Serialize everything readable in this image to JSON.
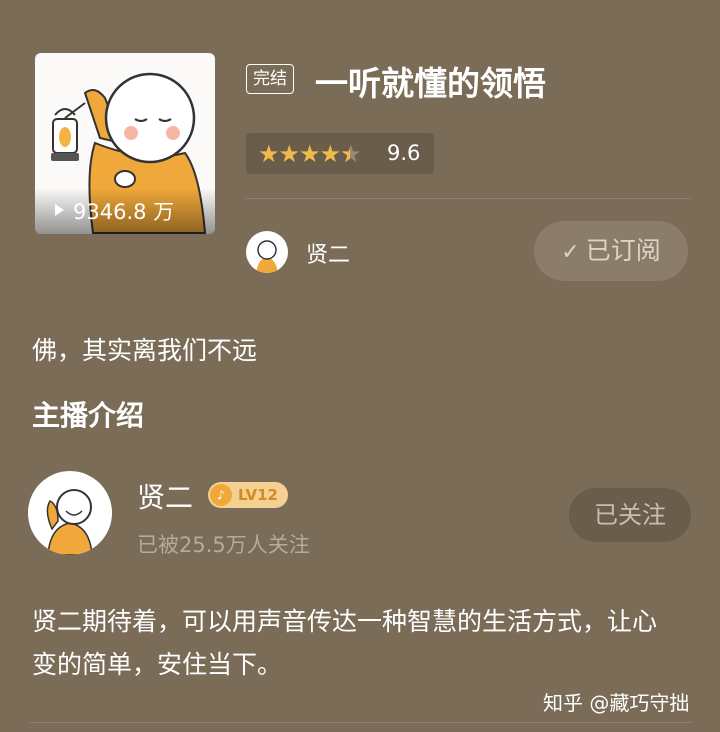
{
  "album": {
    "play_count": "9346.8 万",
    "status_badge": "完结",
    "title": "一听就懂的领悟",
    "stars": "★★★★",
    "half_star": "★",
    "score": "9.6",
    "author_name": "贤二",
    "subscribe_label": "已订阅",
    "subscribe_check": "✓",
    "intro": "佛，其实离我们不远"
  },
  "anchor_section": {
    "title": "主播介绍",
    "name": "贤二",
    "level": "LV12",
    "followers": "已被25.5万人关注",
    "follow_label": "已关注",
    "description": "贤二期待着，可以用声音传达一种智慧的生活方式，让心变的简单，安住当下。"
  },
  "watermark": "知乎 @藏巧守拙",
  "colors": {
    "background": "#7b6c58",
    "star": "#f0b94a",
    "level_badge": "#f4d193",
    "robe": "#f0a83a"
  },
  "icons": {
    "play": "play-icon",
    "check": "check-icon",
    "level": "level-badge-icon"
  }
}
